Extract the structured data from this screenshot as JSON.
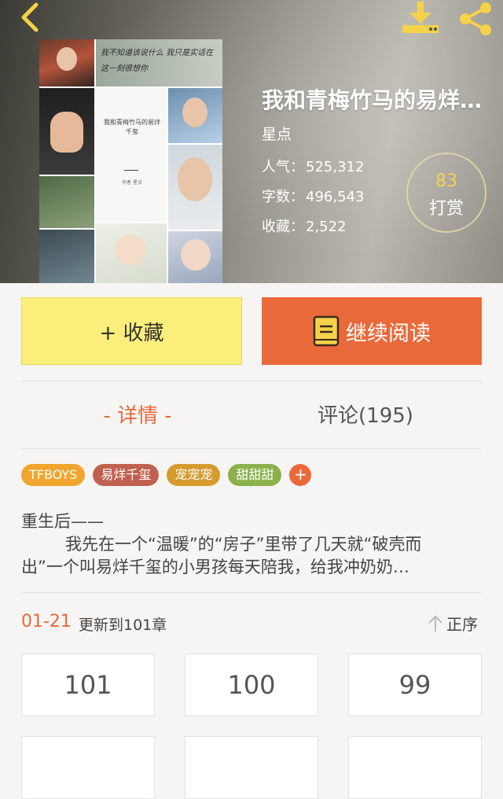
{
  "book": {
    "title": "我和青梅竹马的易烊…",
    "author": "星点",
    "stats": [
      {
        "label": "人气：",
        "value": "525,312"
      },
      {
        "label": "字数：",
        "value": "496,543"
      },
      {
        "label": "收藏：",
        "value": "2,522"
      }
    ],
    "reward": {
      "count": "83",
      "label": "打赏"
    },
    "cover": {
      "mini_title": "我和青梅竹马的易烊千玺",
      "mini_author": "作者 星点",
      "handwriting": "我不知道该说什么 我只是实话在这一刻很想你"
    }
  },
  "actions": {
    "favorite_label": "+ 收藏",
    "read_label": "继续阅读"
  },
  "tabs": {
    "detail": "- 详情 -",
    "comments": "评论(195)"
  },
  "tags": [
    {
      "label": "TFBOYS",
      "color": "#f0a52e"
    },
    {
      "label": "易烊千玺",
      "color": "#c0614f"
    },
    {
      "label": "宠宠宠",
      "color": "#d69b2f"
    },
    {
      "label": "甜甜甜",
      "color": "#8cb04a"
    }
  ],
  "tag_add": {
    "label": "+",
    "color": "#e9693b"
  },
  "synopsis": {
    "line1": "重生后——",
    "line2": "我先在一个“温暖”的“房子”里带了几天就“破壳而",
    "line3": "出”一个叫易烊千玺的小男孩每天陪我，给我冲奶奶…"
  },
  "chapters": {
    "date": "01-21",
    "update_text": "更新到101章",
    "sort_label": "正序",
    "items": [
      "101",
      "100",
      "99",
      "",
      "",
      ""
    ]
  },
  "colors": {
    "accent": "#e9693b",
    "fav_button": "#fbee7a",
    "icon_yellow": "#f6d24a"
  }
}
